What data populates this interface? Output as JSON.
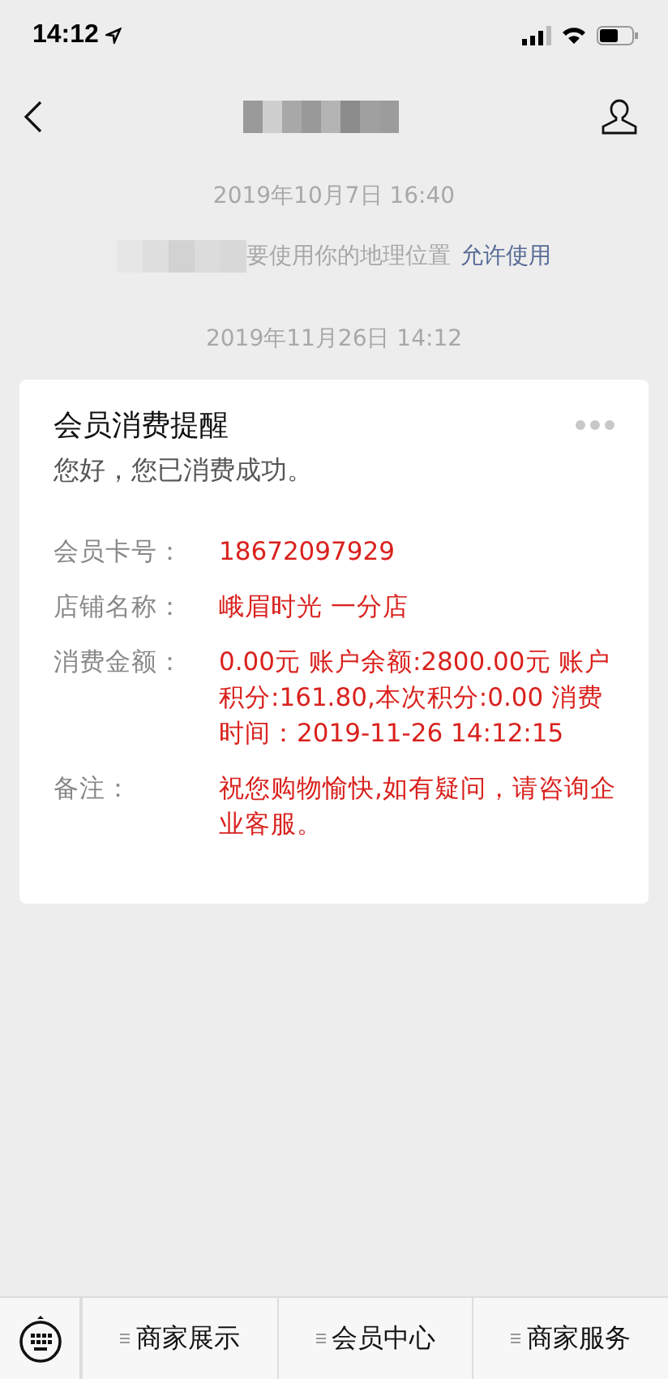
{
  "status_bar": {
    "time": "14:12"
  },
  "messages": [
    {
      "kind": "time",
      "text": "2019年10月7日 16:40"
    },
    {
      "kind": "notice",
      "text": "要使用你的地理位置",
      "link": "允许使用"
    },
    {
      "kind": "time",
      "text": "2019年11月26日 14:12"
    },
    {
      "kind": "card",
      "title": "会员消费提醒",
      "subtitle": "您好，您已消费成功。",
      "rows": [
        {
          "label": "会员卡号：",
          "value": "18672097929"
        },
        {
          "label": "店铺名称：",
          "value": "峨眉时光 一分店"
        },
        {
          "label": "消费金额：",
          "value": "0.00元 账户余额:2800.00元 账户积分:161.80,本次积分:0.00 消费时间：2019-11-26 14:12:15"
        },
        {
          "label": "备注：",
          "value": "祝您购物愉快,如有疑问，请咨询企业客服。"
        }
      ]
    }
  ],
  "menu": [
    {
      "label": "商家展示"
    },
    {
      "label": "会员中心"
    },
    {
      "label": "商家服务"
    }
  ]
}
